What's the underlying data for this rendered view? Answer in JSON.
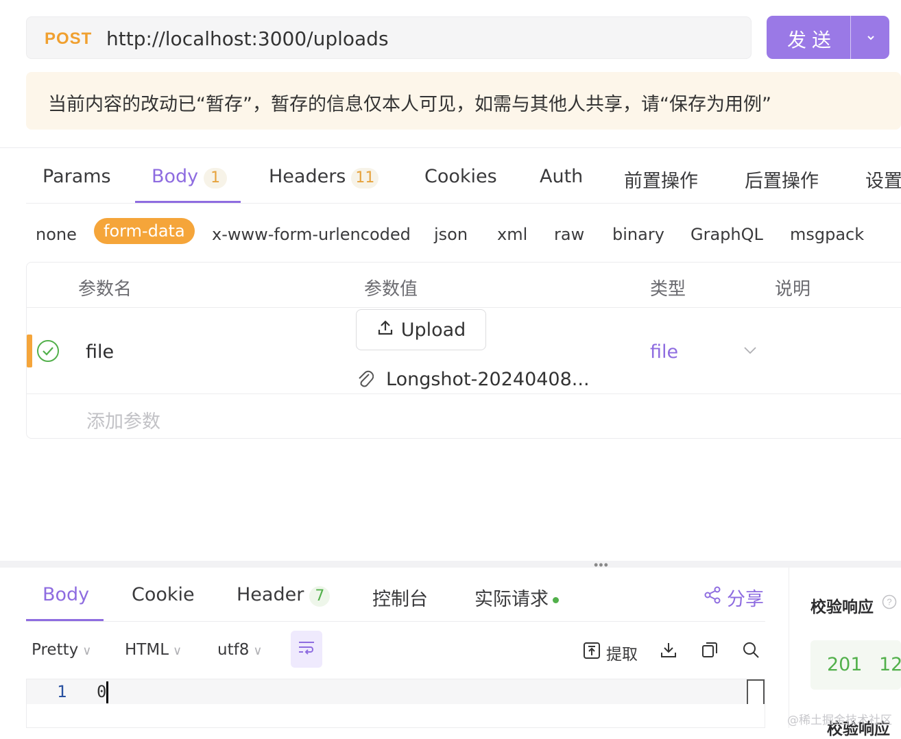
{
  "request": {
    "method": "POST",
    "url": "http://localhost:3000/uploads",
    "send_label": "发送"
  },
  "notice": "当前内容的改动已“暂存”，暂存的信息仅本人可见，如需与其他人共享，请“保存为用例”",
  "tabs": [
    {
      "label": "Params"
    },
    {
      "label": "Body",
      "badge": "1"
    },
    {
      "label": "Headers",
      "badge": "11"
    },
    {
      "label": "Cookies"
    },
    {
      "label": "Auth"
    },
    {
      "label": "前置操作"
    },
    {
      "label": "后置操作"
    },
    {
      "label": "设置"
    }
  ],
  "body_types": [
    "none",
    "form-data",
    "x-www-form-urlencoded",
    "json",
    "xml",
    "raw",
    "binary",
    "GraphQL",
    "msgpack"
  ],
  "table": {
    "headers": [
      "参数名",
      "参数值",
      "类型",
      "说明"
    ],
    "row": {
      "name": "file",
      "upload_label": "Upload",
      "file_name": "Longshot-20240408...",
      "type": "file"
    },
    "add_placeholder": "添加参数"
  },
  "response": {
    "tabs": [
      {
        "label": "Body"
      },
      {
        "label": "Cookie"
      },
      {
        "label": "Header",
        "badge": "7"
      },
      {
        "label": "控制台"
      },
      {
        "label": "实际请求"
      }
    ],
    "share_label": "分享",
    "options": [
      "Pretty",
      "HTML",
      "utf8"
    ],
    "extract_label": "提取",
    "line_number": "1",
    "code": "0",
    "validate_label": "校验响应",
    "status_code": "201",
    "status_extra": "12",
    "validate_label_2": "校验响应"
  },
  "watermark": "@稀土掘金技术社区",
  "colors": {
    "accent": "#8e6ce0",
    "send": "#9a79e6",
    "method": "#f0a030",
    "active_body_type": "#f5a53a",
    "success": "#52b04b"
  }
}
